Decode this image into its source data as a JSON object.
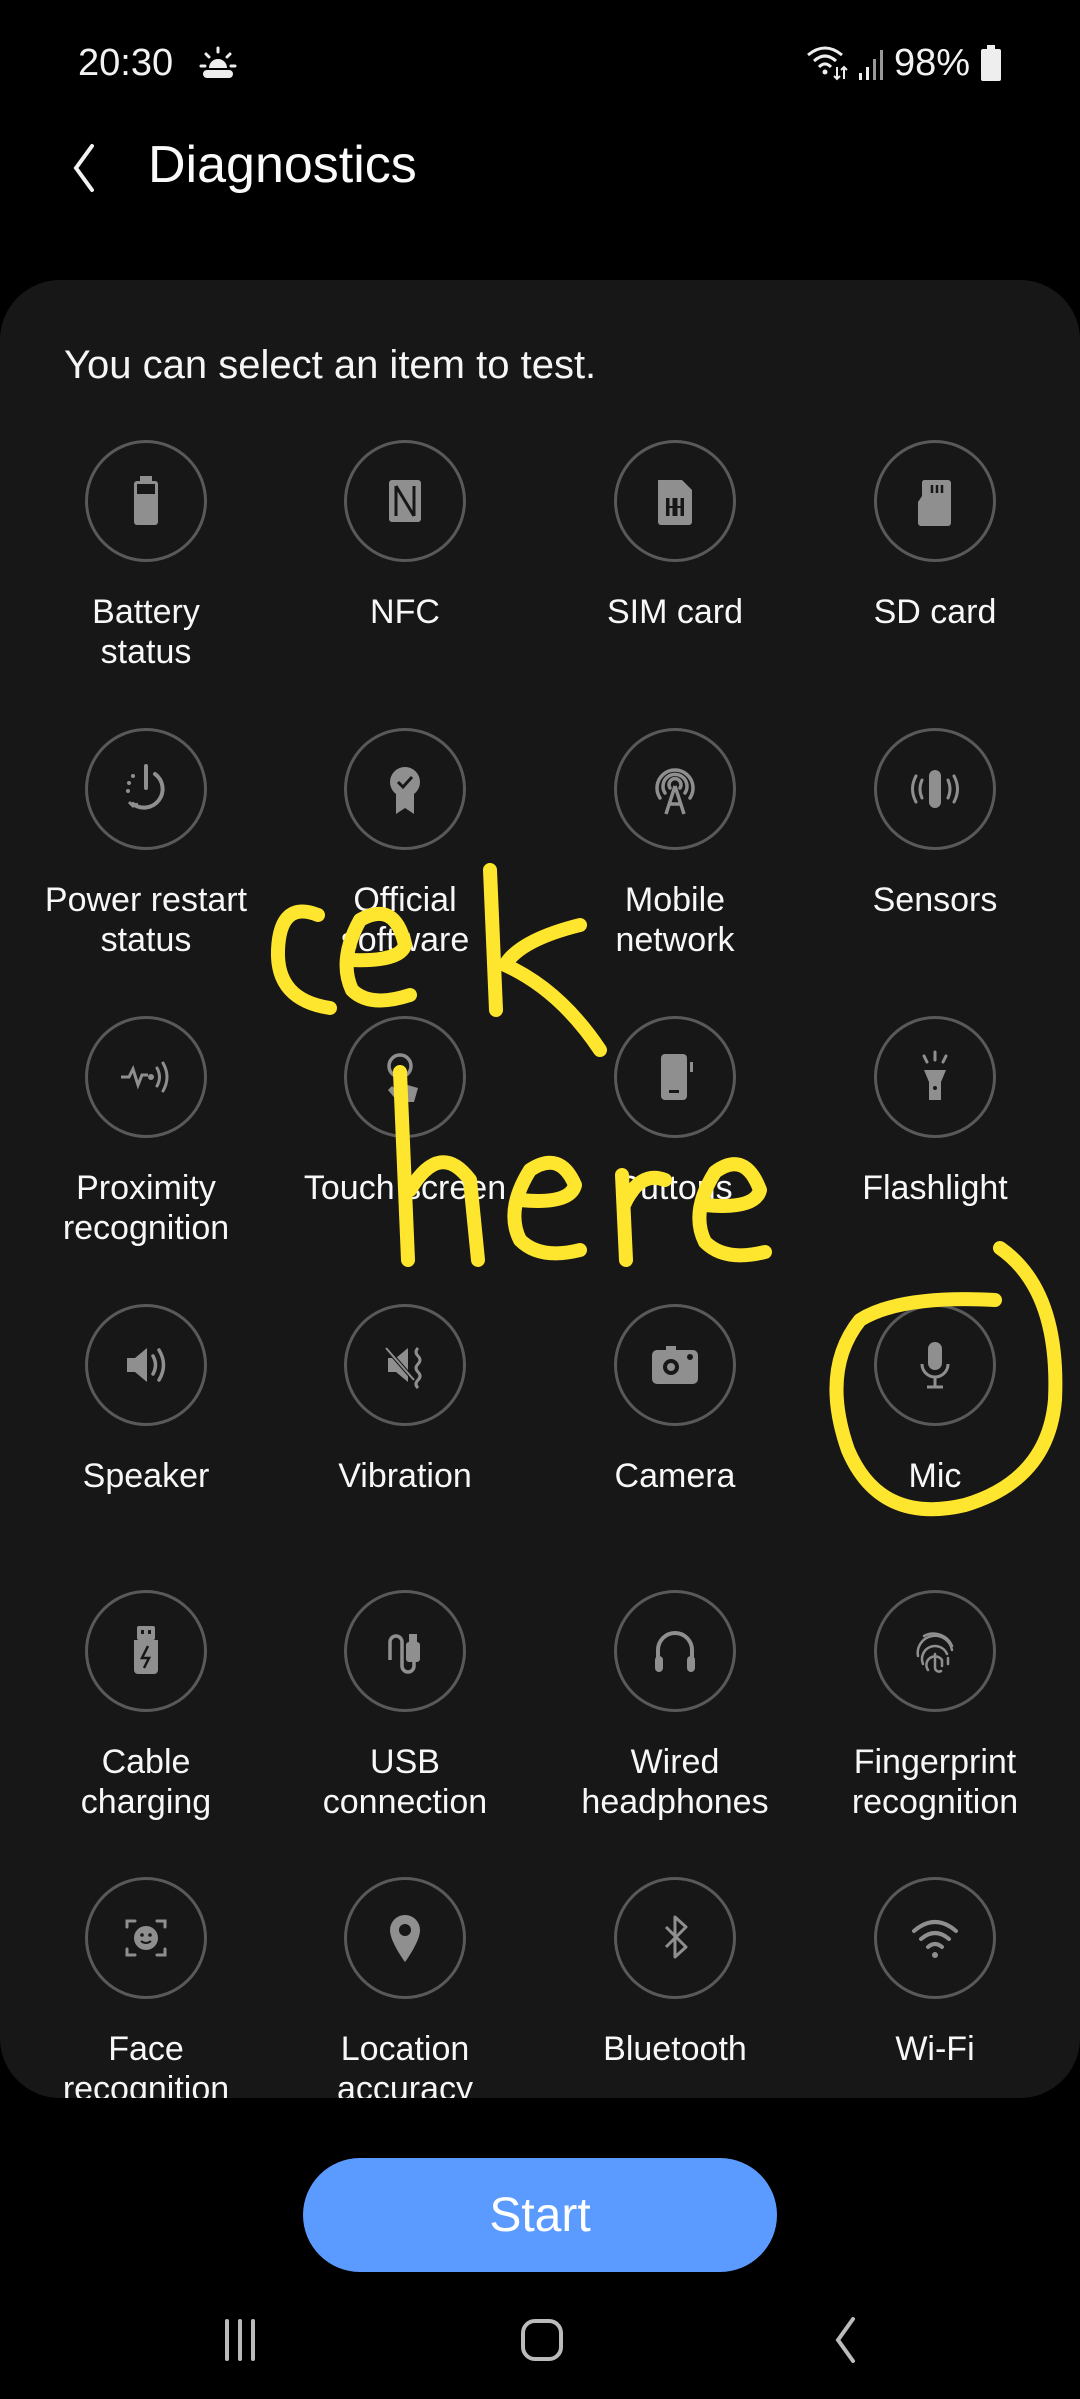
{
  "status_bar": {
    "time": "20:30",
    "weather_icon": "sun-cloud-icon",
    "battery_percent": "98%",
    "icons": [
      "wifi-data-icon",
      "signal-icon",
      "battery-icon"
    ]
  },
  "app_bar": {
    "title": "Diagnostics",
    "back_icon": "back-arrow-icon"
  },
  "card": {
    "subtitle": "You can select an item to test.",
    "items": [
      {
        "label": "Battery\nstatus",
        "icon": "battery-icon"
      },
      {
        "label": "NFC",
        "icon": "nfc-icon"
      },
      {
        "label": "SIM card",
        "icon": "sim-card-icon"
      },
      {
        "label": "SD card",
        "icon": "sd-card-icon"
      },
      {
        "label": "Power restart\nstatus",
        "icon": "power-restart-icon"
      },
      {
        "label": "Official\nsoftware",
        "icon": "certified-badge-icon"
      },
      {
        "label": "Mobile\nnetwork",
        "icon": "antenna-icon"
      },
      {
        "label": "Sensors",
        "icon": "sensor-vibrate-icon"
      },
      {
        "label": "Proximity\nrecognition",
        "icon": "proximity-icon"
      },
      {
        "label": "Touch screen",
        "icon": "touch-icon"
      },
      {
        "label": "Buttons",
        "icon": "phone-buttons-icon"
      },
      {
        "label": "Flashlight",
        "icon": "flashlight-icon"
      },
      {
        "label": "Speaker",
        "icon": "speaker-icon"
      },
      {
        "label": "Vibration",
        "icon": "vibration-icon"
      },
      {
        "label": "Camera",
        "icon": "camera-icon"
      },
      {
        "label": "Mic",
        "icon": "mic-icon"
      },
      {
        "label": "Cable\ncharging",
        "icon": "usb-charging-icon"
      },
      {
        "label": "USB\nconnection",
        "icon": "usb-cable-icon"
      },
      {
        "label": "Wired\nheadphones",
        "icon": "headphones-icon"
      },
      {
        "label": "Fingerprint\nrecognition",
        "icon": "fingerprint-icon"
      },
      {
        "label": "Face\nrecognition",
        "icon": "face-scan-icon"
      },
      {
        "label": "Location\naccuracy",
        "icon": "location-pin-icon"
      },
      {
        "label": "Bluetooth",
        "icon": "bluetooth-icon"
      },
      {
        "label": "Wi-Fi",
        "icon": "wifi-icon"
      }
    ]
  },
  "start_button": {
    "label": "Start",
    "color": "#5b9bff"
  },
  "annotation": {
    "text_line1": "cek",
    "text_line2": "here",
    "color": "#ffe62e",
    "circled_item": "Mic"
  },
  "nav_bar": {
    "buttons": [
      "recent-apps-icon",
      "home-icon",
      "back-icon"
    ]
  }
}
